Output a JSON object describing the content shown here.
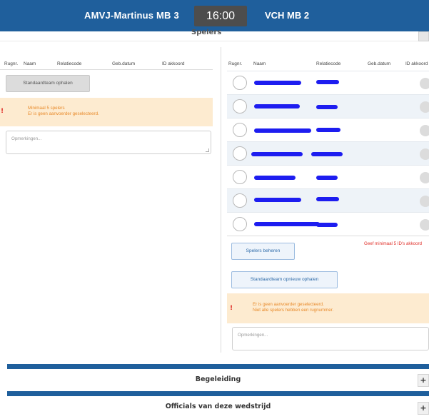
{
  "header": {
    "home_team": "AMVJ-Martinus MB 3",
    "time": "16:00",
    "away_team": "VCH MB 2",
    "section_title": "Spelers"
  },
  "left_panel": {
    "columns": [
      "Rugnr.",
      "Naam",
      "Relatiecode",
      "Geb.datum",
      "ID akkoord"
    ],
    "load_team_button": "Standaardteam ophalen",
    "warning_lines": [
      "Minimaal 5 spelers",
      "Er is geen aanvoerder geselecteerd."
    ],
    "remarks_placeholder": "Opmerkingen..."
  },
  "right_panel": {
    "columns": [
      "Rugnr.",
      "Naam",
      "Relatiecode",
      "Geb.datum",
      "ID akkoord"
    ],
    "player_count": 7,
    "manage_players_button": "Spelers beheren",
    "id_hint": "Geef minimaal 5 ID's akkoord",
    "reload_team_button": "Standaardteam opnieuw ophalen",
    "warning_lines": [
      "Er is geen aanvoerder geselecteerd.",
      "Niet alle spelers hebben een rugnummer."
    ],
    "remarks_placeholder": "Opmerkingen..."
  },
  "sections": [
    {
      "title": "Begeleiding"
    },
    {
      "title": "Officials van deze wedstrijd"
    }
  ],
  "icons": {
    "expand": "plus-icon",
    "warning": "exclamation-icon"
  },
  "colors": {
    "header_blue": "#1f5f9c",
    "warning_bg": "#fdebd0",
    "warning_text": "#e88a2a",
    "error_red": "#e0302a",
    "redaction_blue": "#1d1df0"
  }
}
